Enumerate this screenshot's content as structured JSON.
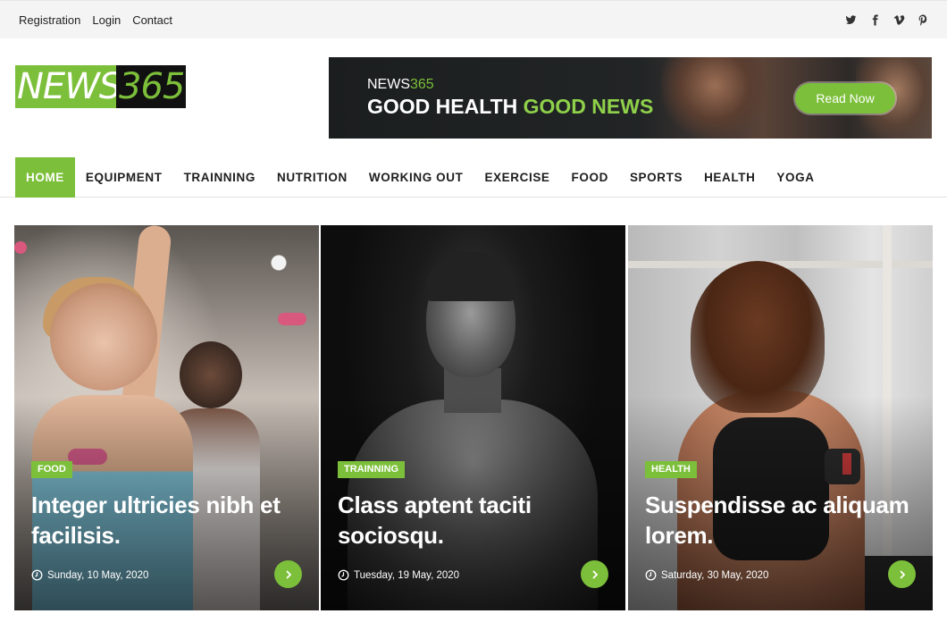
{
  "topbar": {
    "links": [
      {
        "label": "Registration"
      },
      {
        "label": "Login"
      },
      {
        "label": "Contact"
      }
    ],
    "social_icons": [
      "twitter-icon",
      "facebook-icon",
      "vimeo-icon",
      "pinterest-icon"
    ]
  },
  "logo": {
    "part1": "NEWS",
    "part2": "365"
  },
  "banner": {
    "brand_part1": "NEWS",
    "brand_part2": "365",
    "headline_part1": "GOOD HEALTH",
    "headline_part2": "GOOD NEWS",
    "button_label": "Read Now"
  },
  "nav": {
    "items": [
      {
        "label": "HOME",
        "active": true
      },
      {
        "label": "EQUIPMENT"
      },
      {
        "label": "TRAINNING"
      },
      {
        "label": "NUTRITION"
      },
      {
        "label": "WORKING OUT"
      },
      {
        "label": "EXERCISE"
      },
      {
        "label": "FOOD"
      },
      {
        "label": "SPORTS"
      },
      {
        "label": "HEALTH"
      },
      {
        "label": "YOGA"
      }
    ]
  },
  "cards": [
    {
      "category": "FOOD",
      "title": "Integer ultricies nibh et facilisis.",
      "date": "Sunday, 10 May, 2020"
    },
    {
      "category": "TRAINNING",
      "title": "Class aptent taciti sociosqu.",
      "date": "Tuesday, 19 May, 2020"
    },
    {
      "category": "HEALTH",
      "title": "Suspendisse ac aliquam lorem.",
      "date": "Saturday, 30 May, 2020"
    }
  ],
  "colors": {
    "accent": "#7cbf3a",
    "topbar_bg": "#f4f4f4",
    "text_dark": "#1e1e1e"
  }
}
